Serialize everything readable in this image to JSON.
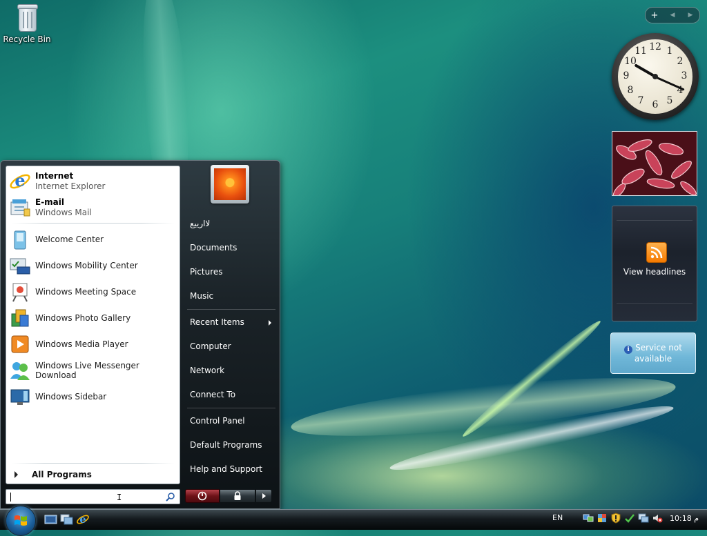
{
  "desktop": {
    "icons": [
      {
        "label": "Recycle Bin",
        "icon": "recycle-bin-icon"
      }
    ]
  },
  "sidebar": {
    "controls": {
      "add": "+",
      "prev": "◀",
      "next": "▶"
    },
    "clock": {
      "numbers": [
        "12",
        "1",
        "2",
        "3",
        "4",
        "5",
        "6",
        "7",
        "8",
        "9",
        "10",
        "11"
      ]
    },
    "feeds": {
      "label": "View headlines",
      "icon": "rss-icon"
    },
    "weather": {
      "message": "Service not available",
      "icon": "info-icon"
    }
  },
  "start_menu": {
    "pinned": [
      {
        "title": "Internet",
        "subtitle": "Internet Explorer",
        "icon": "internet-explorer-icon"
      },
      {
        "title": "E-mail",
        "subtitle": "Windows Mail",
        "icon": "windows-mail-icon"
      }
    ],
    "recent": [
      {
        "label": "Welcome Center",
        "icon": "welcome-center-icon"
      },
      {
        "label": "Windows Mobility Center",
        "icon": "mobility-center-icon"
      },
      {
        "label": "Windows Meeting Space",
        "icon": "meeting-space-icon"
      },
      {
        "label": "Windows Photo Gallery",
        "icon": "photo-gallery-icon"
      },
      {
        "label": "Windows Media Player",
        "icon": "media-player-icon"
      },
      {
        "label": "Windows Live Messenger Download",
        "icon": "messenger-icon"
      },
      {
        "label": "Windows Sidebar",
        "icon": "sidebar-icon"
      }
    ],
    "all_programs": "All Programs",
    "search_placeholder": "",
    "right": {
      "user_name": "لاارييع",
      "items": [
        "Documents",
        "Pictures",
        "Music",
        "Recent Items",
        "Computer",
        "Network",
        "Connect To",
        "Control Panel",
        "Default Programs",
        "Help and Support"
      ]
    }
  },
  "taskbar": {
    "language": "EN",
    "time": "10:18 م",
    "quick_launch": [
      "show-desktop-icon",
      "switch-windows-icon",
      "internet-explorer-icon"
    ],
    "tray_icons": [
      "network-status-icon",
      "security-center-icon",
      "windows-defender-icon",
      "windows-update-icon",
      "network-icon",
      "volume-muted-icon"
    ]
  },
  "colors": {
    "accent_blue": "#1b5f9b",
    "power_red": "#6d1218",
    "rss_orange": "#f57a00"
  }
}
